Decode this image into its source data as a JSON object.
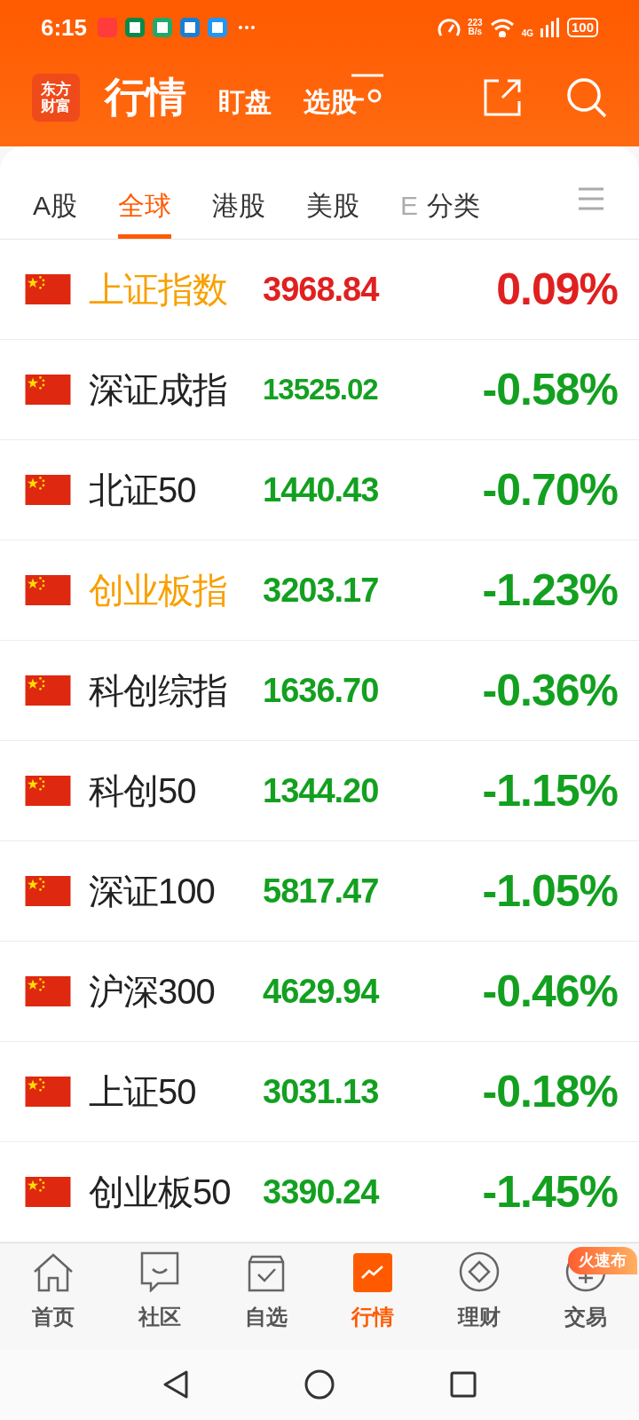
{
  "status_bar": {
    "time": "6:15",
    "net_speed_value": "223",
    "net_speed_unit": "B/s",
    "network": "4G",
    "battery": "100"
  },
  "header": {
    "logo_line1": "东方",
    "logo_line2": "财富",
    "title": "行情",
    "links": [
      "盯盘",
      "选股"
    ]
  },
  "tabs": [
    {
      "label": "A股",
      "selected": false,
      "faded": false
    },
    {
      "label": "全球",
      "selected": true,
      "faded": false
    },
    {
      "label": "港股",
      "selected": false,
      "faded": false
    },
    {
      "label": "美股",
      "selected": false,
      "faded": false
    },
    {
      "label": "E",
      "selected": false,
      "faded": true
    },
    {
      "label": "分类",
      "selected": false,
      "faded": false
    }
  ],
  "indices": [
    {
      "name": "上证指数",
      "highlighted": true,
      "price": "3968.84",
      "change": "0.09%",
      "rising": true
    },
    {
      "name": "深证成指",
      "highlighted": false,
      "price": "13525.02",
      "change": "-0.58%",
      "rising": false
    },
    {
      "name": "北证50",
      "highlighted": false,
      "price": "1440.43",
      "change": "-0.70%",
      "rising": false
    },
    {
      "name": "创业板指",
      "highlighted": true,
      "price": "3203.17",
      "change": "-1.23%",
      "rising": false
    },
    {
      "name": "科创综指",
      "highlighted": false,
      "price": "1636.70",
      "change": "-0.36%",
      "rising": false
    },
    {
      "name": "科创50",
      "highlighted": false,
      "price": "1344.20",
      "change": "-1.15%",
      "rising": false
    },
    {
      "name": "深证100",
      "highlighted": false,
      "price": "5817.47",
      "change": "-1.05%",
      "rising": false
    },
    {
      "name": "沪深300",
      "highlighted": false,
      "price": "4629.94",
      "change": "-0.46%",
      "rising": false
    },
    {
      "name": "上证50",
      "highlighted": false,
      "price": "3031.13",
      "change": "-0.18%",
      "rising": false
    },
    {
      "name": "创业板50",
      "highlighted": false,
      "price": "3390.24",
      "change": "-1.45%",
      "rising": false
    }
  ],
  "bottom_nav": [
    {
      "label": "首页",
      "kind": "home",
      "selected": false
    },
    {
      "label": "社区",
      "kind": "community",
      "selected": false
    },
    {
      "label": "自选",
      "kind": "watchlist",
      "selected": false
    },
    {
      "label": "行情",
      "kind": "market",
      "selected": true
    },
    {
      "label": "理财",
      "kind": "wealth",
      "selected": false
    },
    {
      "label": "交易",
      "kind": "trade",
      "selected": false,
      "badge": "火速布"
    }
  ]
}
